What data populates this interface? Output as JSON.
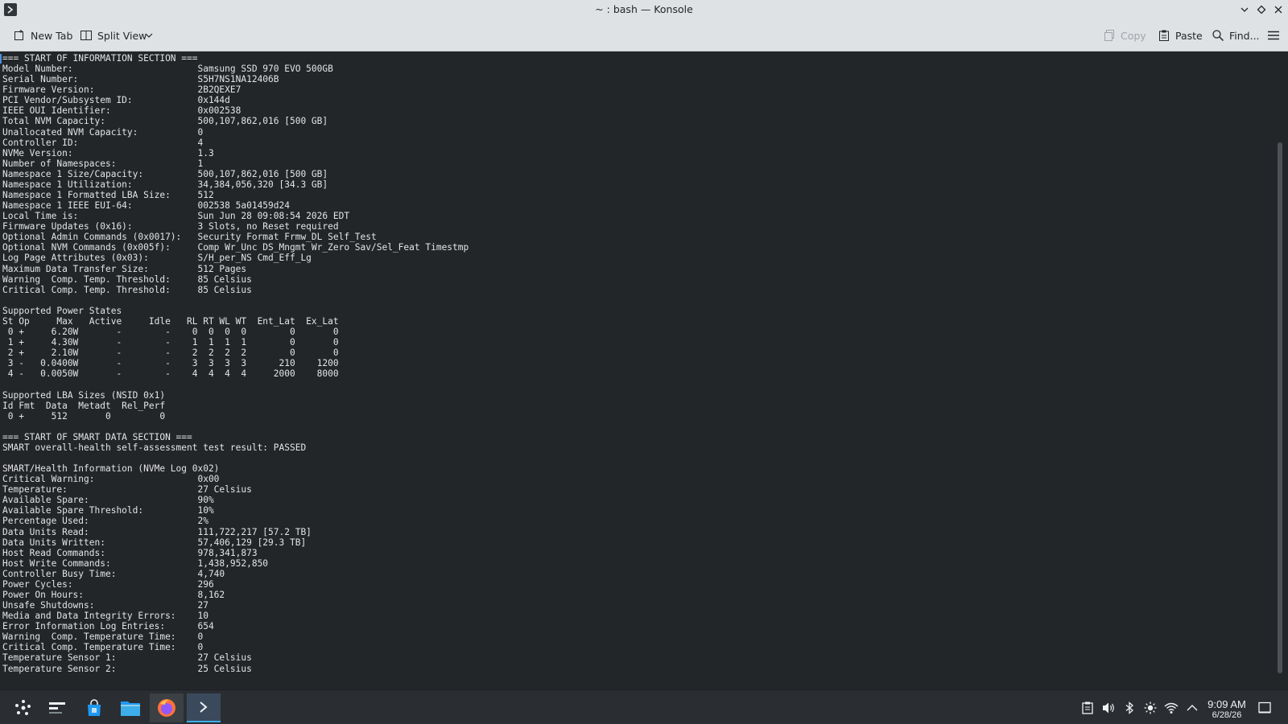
{
  "window": {
    "title": "~ : bash — Konsole"
  },
  "toolbar": {
    "new_tab": "New Tab",
    "split_view": "Split View",
    "copy": "Copy",
    "paste": "Paste",
    "find": "Find..."
  },
  "terminal": {
    "lines": [
      "=== START OF INFORMATION SECTION ===",
      "Model Number:                       Samsung SSD 970 EVO 500GB",
      "Serial Number:                      S5H7NS1NA12406B",
      "Firmware Version:                   2B2QEXE7",
      "PCI Vendor/Subsystem ID:            0x144d",
      "IEEE OUI Identifier:                0x002538",
      "Total NVM Capacity:                 500,107,862,016 [500 GB]",
      "Unallocated NVM Capacity:           0",
      "Controller ID:                      4",
      "NVMe Version:                       1.3",
      "Number of Namespaces:               1",
      "Namespace 1 Size/Capacity:          500,107,862,016 [500 GB]",
      "Namespace 1 Utilization:            34,384,056,320 [34.3 GB]",
      "Namespace 1 Formatted LBA Size:     512",
      "Namespace 1 IEEE EUI-64:            002538 5a01459d24",
      "Local Time is:                      Sun Jun 28 09:08:54 2026 EDT",
      "Firmware Updates (0x16):            3 Slots, no Reset required",
      "Optional Admin Commands (0x0017):   Security Format Frmw_DL Self_Test",
      "Optional NVM Commands (0x005f):     Comp Wr_Unc DS_Mngmt Wr_Zero Sav/Sel_Feat Timestmp",
      "Log Page Attributes (0x03):         S/H_per_NS Cmd_Eff_Lg",
      "Maximum Data Transfer Size:         512 Pages",
      "Warning  Comp. Temp. Threshold:     85 Celsius",
      "Critical Comp. Temp. Threshold:     85 Celsius",
      "",
      "Supported Power States",
      "St Op     Max   Active     Idle   RL RT WL WT  Ent_Lat  Ex_Lat",
      " 0 +     6.20W       -        -    0  0  0  0        0       0",
      " 1 +     4.30W       -        -    1  1  1  1        0       0",
      " 2 +     2.10W       -        -    2  2  2  2        0       0",
      " 3 -   0.0400W       -        -    3  3  3  3      210    1200",
      " 4 -   0.0050W       -        -    4  4  4  4     2000    8000",
      "",
      "Supported LBA Sizes (NSID 0x1)",
      "Id Fmt  Data  Metadt  Rel_Perf",
      " 0 +     512       0         0",
      "",
      "=== START OF SMART DATA SECTION ===",
      "SMART overall-health self-assessment test result: PASSED",
      "",
      "SMART/Health Information (NVMe Log 0x02)",
      "Critical Warning:                   0x00",
      "Temperature:                        27 Celsius",
      "Available Spare:                    90%",
      "Available Spare Threshold:          10%",
      "Percentage Used:                    2%",
      "Data Units Read:                    111,722,217 [57.2 TB]",
      "Data Units Written:                 57,406,129 [29.3 TB]",
      "Host Read Commands:                 978,341,873",
      "Host Write Commands:                1,438,952,850",
      "Controller Busy Time:               4,740",
      "Power Cycles:                       296",
      "Power On Hours:                     8,162",
      "Unsafe Shutdowns:                   27",
      "Media and Data Integrity Errors:    10",
      "Error Information Log Entries:      654",
      "Warning  Comp. Temperature Time:    0",
      "Critical Comp. Temperature Time:    0",
      "Temperature Sensor 1:               27 Celsius",
      "Temperature Sensor 2:               25 Celsius"
    ]
  },
  "taskbar": {
    "apps": [
      "app-launcher",
      "overview",
      "discover",
      "dolphin",
      "firefox",
      "konsole"
    ],
    "clock_time": "9:09 AM",
    "clock_date": "6/28/26"
  },
  "colors": {
    "terminal_bg": "#232629",
    "terminal_fg": "#e4e4e4",
    "chrome_bg": "#dfe2e5",
    "accent": "#3daee9"
  }
}
